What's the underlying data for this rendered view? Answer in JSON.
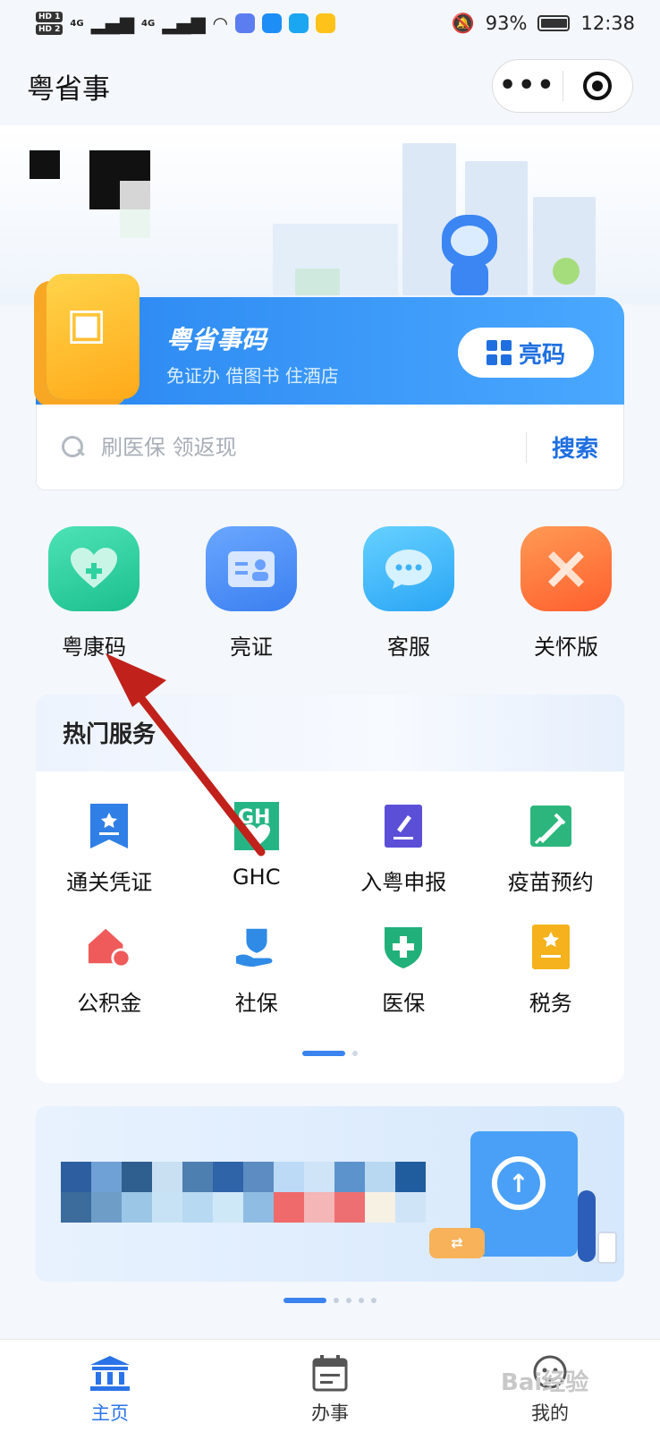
{
  "status_bar": {
    "hd1": "HD 1",
    "hd2": "HD 2",
    "signal1": "4G",
    "signal2": "4G",
    "battery": "93%",
    "time": "12:38"
  },
  "header": {
    "title": "粤省事",
    "more_label": "•••"
  },
  "code_card": {
    "title": "粤省事码",
    "subtitle": "免证办 借图书 住酒店",
    "button": "亮码"
  },
  "search": {
    "placeholder": "刷医保 领返现",
    "button": "搜索"
  },
  "quick_entries": [
    {
      "label": "粤康码",
      "icon": "heart-icon",
      "color": "#2fd1a0"
    },
    {
      "label": "亮证",
      "icon": "id-card-icon",
      "color": "#4a8ff6"
    },
    {
      "label": "客服",
      "icon": "chat-bubble-icon",
      "color": "#3fb2f8"
    },
    {
      "label": "关怀版",
      "icon": "care-cross-icon",
      "color": "#ff7a3d"
    }
  ],
  "hot_services": {
    "title": "热门服务",
    "items": [
      {
        "label": "通关凭证",
        "icon": "certificate-icon",
        "color": "#2f7fe6"
      },
      {
        "label": "GHC",
        "icon": "ghc-icon",
        "color": "#25b585"
      },
      {
        "label": "入粤申报",
        "icon": "edit-doc-icon",
        "color": "#5b4fd8"
      },
      {
        "label": "疫苗预约",
        "icon": "vaccine-icon",
        "color": "#2cb67d"
      },
      {
        "label": "公积金",
        "icon": "house-fund-icon",
        "color": "#ef5a5a"
      },
      {
        "label": "社保",
        "icon": "social-security-icon",
        "color": "#2f8be6"
      },
      {
        "label": "医保",
        "icon": "medical-shield-icon",
        "color": "#22b07a"
      },
      {
        "label": "税务",
        "icon": "tax-icon",
        "color": "#f5b21c"
      }
    ]
  },
  "banner": {
    "swap_label": "⇄"
  },
  "nav": [
    {
      "label": "主页",
      "icon": "home-bank-icon",
      "active": true
    },
    {
      "label": "办事",
      "icon": "calendar-icon",
      "active": false
    },
    {
      "label": "我的",
      "icon": "user-icon",
      "active": false
    }
  ],
  "watermark": "Bai经验"
}
